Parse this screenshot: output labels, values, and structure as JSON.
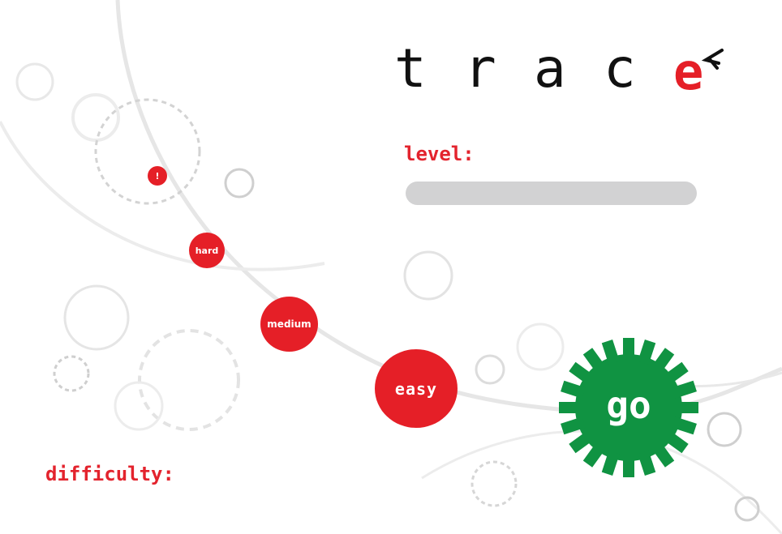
{
  "logo": {
    "letters": [
      "t",
      "r",
      "a",
      "c"
    ],
    "mark_letter": "e",
    "mark_color": "#e51f27",
    "arrow_icon": "arrow-left-icon"
  },
  "level": {
    "label": "level:",
    "value": ""
  },
  "difficulty": {
    "label": "difficulty:",
    "options": {
      "warning": "!",
      "hard": "hard",
      "medium": "medium",
      "easy": "easy"
    }
  },
  "go": {
    "label": "go",
    "color": "#109342"
  },
  "colors": {
    "accent": "#e51f27",
    "track": "#e6e6e6",
    "bar": "#d2d2d3"
  }
}
